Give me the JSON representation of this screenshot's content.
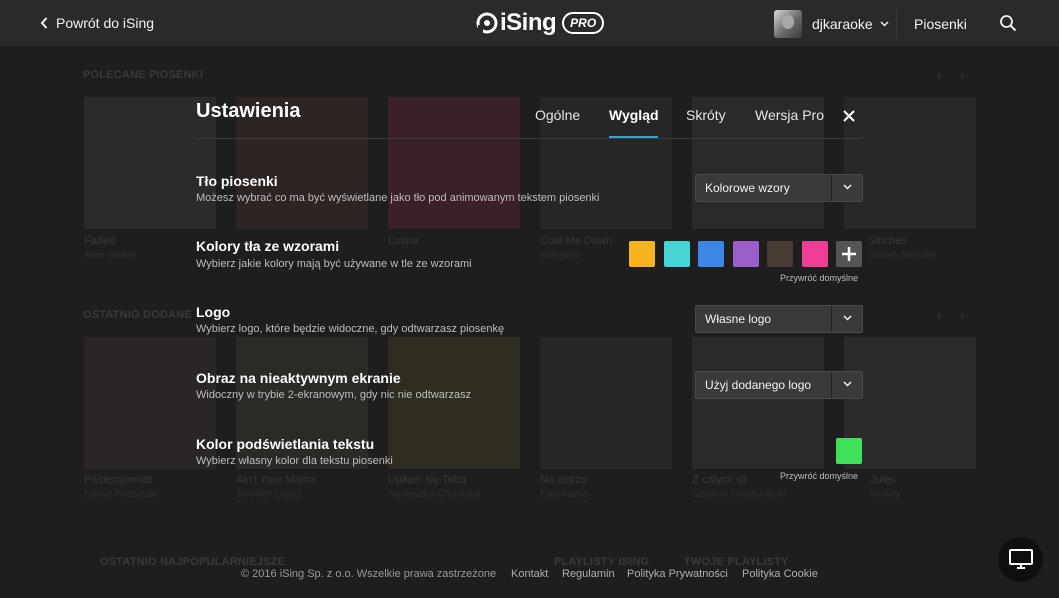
{
  "topbar": {
    "back_label": "Powrót do iSing",
    "logo_text": "iSing",
    "pro_badge": "PRO",
    "username": "djkaraoke",
    "songs_link": "Piosenki"
  },
  "background": {
    "sections": [
      "POLECANE PIOSENKI",
      "OSTATNIO DODANE",
      "OSTATNIO NAJPOPULARNIEJSZE",
      "PLAYLISTY ISING",
      "TWOJE PLAYLISTY"
    ],
    "row1": [
      {
        "title": "Faded",
        "artist": "Alan Walker"
      },
      {
        "title": "",
        "artist": ""
      },
      {
        "title": "Lustra",
        "artist": ""
      },
      {
        "title": "Cool Me Down",
        "artist": "Margaret"
      },
      {
        "title": "",
        "artist": ""
      },
      {
        "title": "Stitches",
        "artist": "Shawn Mendes"
      }
    ],
    "row2": [
      {
        "title": "Pastempomat",
        "artist": "Dawid Podsiadło"
      },
      {
        "title": "Ain't Your Mama",
        "artist": "Jennifer Lopez"
      },
      {
        "title": "Upiłam się Tobą",
        "artist": "Agnieszka Chylińska"
      },
      {
        "title": "Na ostrzu",
        "artist": "Ewa Farna"
      },
      {
        "title": "Z całych sił",
        "artist": "Szymon Chodyniecki"
      },
      {
        "title": "Jules",
        "artist": "Mowiły"
      }
    ]
  },
  "settings": {
    "title": "Ustawienia",
    "tabs": [
      {
        "label": "Ogólne",
        "active": false
      },
      {
        "label": "Wygląd",
        "active": true
      },
      {
        "label": "Skróty",
        "active": false
      },
      {
        "label": "Wersja Pro",
        "active": false
      }
    ],
    "rows": {
      "background": {
        "label": "Tło piosenki",
        "desc": "Możesz wybrać co ma być wyświetlane jako tło pod animowanym tekstem piosenki",
        "value": "Kolorowe wzory"
      },
      "colors": {
        "label": "Kolory tła ze wzorami",
        "desc": "Wybierz jakie kolory mają być używane w tle ze wzorami",
        "swatches": [
          "#f5b41f",
          "#46d4d4",
          "#3e86e6",
          "#9b5fc9",
          "#4a3a34",
          "#ef3f95"
        ],
        "restore": "Przywróć domyślne"
      },
      "logo": {
        "label": "Logo",
        "desc": "Wybierz logo, które będzie widoczne, gdy odtwarzasz piosenkę",
        "value": "Własne logo"
      },
      "idle_screen": {
        "label": "Obraz na nieaktywnym ekranie",
        "desc": "Widoczny w trybie 2-ekranowym, gdy nic nie odtwarzasz",
        "value": "Użyj dodanego logo"
      },
      "highlight": {
        "label": "Kolor podświetlania tekstu",
        "desc": "Wybierz własny kolor dla tekstu piosenki",
        "color": "#3fe05a",
        "restore": "Przywróć domyślne"
      }
    }
  },
  "footer": {
    "copyright": "© 2016 iSing Sp. z o.o. Wszelkie prawa zastrzeżone",
    "links": [
      "Kontakt",
      "Regulamin",
      "Polityka Prywatności",
      "Polityka Cookie"
    ]
  },
  "colors": {
    "accent_underline": "#3aa1c9",
    "topbar_bg": "#2a2a2a",
    "page_bg": "#1e1e1e"
  }
}
